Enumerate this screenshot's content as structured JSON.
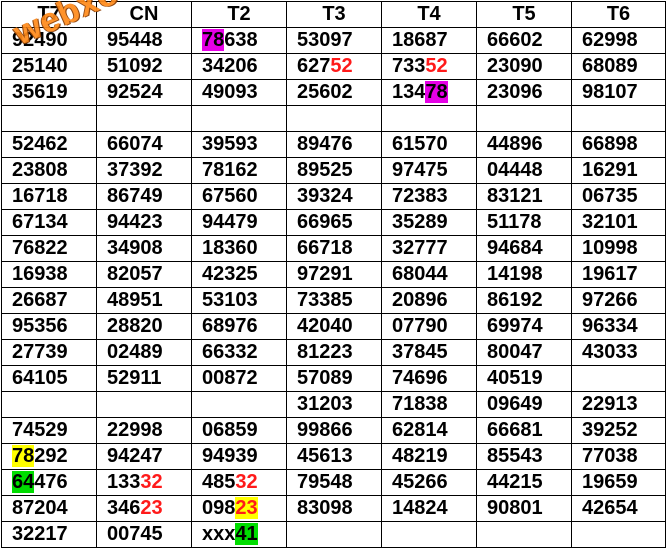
{
  "headers": [
    "T7",
    "CN",
    "T2",
    "T3",
    "T4",
    "T5",
    "T6"
  ],
  "watermark": "webxoso.net",
  "rows": [
    [
      {
        "t": "92490"
      },
      {
        "t": "95448"
      },
      {
        "p": "",
        "s": "78",
        "h": "magenta",
        "x": "638"
      },
      {
        "t": "53097"
      },
      {
        "t": "18687"
      },
      {
        "t": "66602"
      },
      {
        "t": "62998"
      }
    ],
    [
      {
        "t": "25140"
      },
      {
        "t": "51092"
      },
      {
        "t": "34206"
      },
      {
        "p": "627",
        "s": "52",
        "h": "red"
      },
      {
        "p": "733",
        "s": "52",
        "h": "red"
      },
      {
        "t": "23090"
      },
      {
        "t": "68089"
      }
    ],
    [
      {
        "t": "35619"
      },
      {
        "t": "92524"
      },
      {
        "t": "49093"
      },
      {
        "t": "25602"
      },
      {
        "p": "134",
        "s": "78",
        "h": "magenta"
      },
      {
        "t": "23096"
      },
      {
        "t": "98107"
      }
    ],
    [
      {
        "t": ""
      },
      {
        "t": ""
      },
      {
        "t": ""
      },
      {
        "t": ""
      },
      {
        "t": ""
      },
      {
        "t": ""
      },
      {
        "t": ""
      }
    ],
    [
      {
        "t": "52462"
      },
      {
        "t": "66074"
      },
      {
        "t": "39593"
      },
      {
        "t": "89476"
      },
      {
        "t": "61570"
      },
      {
        "t": "44896"
      },
      {
        "t": "66898"
      }
    ],
    [
      {
        "t": "23808"
      },
      {
        "t": "37392"
      },
      {
        "t": "78162"
      },
      {
        "t": "89525"
      },
      {
        "t": "97475"
      },
      {
        "t": "04448"
      },
      {
        "t": "16291"
      }
    ],
    [
      {
        "t": "16718"
      },
      {
        "t": "86749"
      },
      {
        "t": "67560"
      },
      {
        "t": "39324"
      },
      {
        "t": "72383"
      },
      {
        "t": "83121"
      },
      {
        "t": "06735"
      }
    ],
    [
      {
        "t": "67134"
      },
      {
        "t": "94423"
      },
      {
        "t": "94479"
      },
      {
        "t": "66965"
      },
      {
        "t": "35289"
      },
      {
        "t": "51178"
      },
      {
        "t": "32101"
      }
    ],
    [
      {
        "t": "76822"
      },
      {
        "t": "34908"
      },
      {
        "t": "18360"
      },
      {
        "t": "66718"
      },
      {
        "t": "32777"
      },
      {
        "t": "94684"
      },
      {
        "t": "10998"
      }
    ],
    [
      {
        "t": "16938"
      },
      {
        "t": "82057"
      },
      {
        "t": "42325"
      },
      {
        "t": "97291"
      },
      {
        "t": "68044"
      },
      {
        "t": "14198"
      },
      {
        "t": "19617"
      }
    ],
    [
      {
        "t": "26687"
      },
      {
        "t": "48951"
      },
      {
        "t": "53103"
      },
      {
        "t": "73385"
      },
      {
        "t": "20896"
      },
      {
        "t": "86192"
      },
      {
        "t": "97266"
      }
    ],
    [
      {
        "t": "95356"
      },
      {
        "t": "28820"
      },
      {
        "t": "68976"
      },
      {
        "t": "42040"
      },
      {
        "t": "07790"
      },
      {
        "t": "69974"
      },
      {
        "t": "96334"
      }
    ],
    [
      {
        "t": "27739"
      },
      {
        "t": "02489"
      },
      {
        "t": "66332"
      },
      {
        "t": "81223"
      },
      {
        "t": "37845"
      },
      {
        "t": "80047"
      },
      {
        "t": "43033"
      }
    ],
    [
      {
        "t": "64105"
      },
      {
        "t": "52911"
      },
      {
        "t": "00872"
      },
      {
        "t": "57089"
      },
      {
        "t": "74696"
      },
      {
        "t": "40519"
      },
      {
        "t": ""
      }
    ],
    [
      {
        "t": ""
      },
      {
        "t": ""
      },
      {
        "t": ""
      },
      {
        "t": "31203"
      },
      {
        "t": "71838"
      },
      {
        "t": "09649"
      },
      {
        "t": "22913"
      }
    ],
    [
      {
        "t": "74529"
      },
      {
        "t": "22998"
      },
      {
        "t": "06859"
      },
      {
        "t": "99866"
      },
      {
        "t": "62814"
      },
      {
        "t": "66681"
      },
      {
        "t": "39252"
      }
    ],
    [
      {
        "p": "",
        "s": "78",
        "h": "yellow",
        "x": "292"
      },
      {
        "t": "94247"
      },
      {
        "t": "94939"
      },
      {
        "t": "45613"
      },
      {
        "t": "48219"
      },
      {
        "t": "85543"
      },
      {
        "t": "77038"
      }
    ],
    [
      {
        "p": "",
        "s": "64",
        "h": "green",
        "x": "476"
      },
      {
        "p": "133",
        "s": "32",
        "h": "red"
      },
      {
        "p": "485",
        "s": "32",
        "h": "red"
      },
      {
        "t": "79548"
      },
      {
        "t": "45266"
      },
      {
        "t": "44215"
      },
      {
        "t": "19659"
      }
    ],
    [
      {
        "t": "87204"
      },
      {
        "p": "346",
        "s": "23",
        "h": "red"
      },
      {
        "p": "098",
        "s": "23",
        "h": "yellow-red"
      },
      {
        "t": "83098"
      },
      {
        "t": "14824"
      },
      {
        "t": "90801"
      },
      {
        "t": "42654"
      }
    ],
    [
      {
        "t": "32217"
      },
      {
        "t": "00745"
      },
      {
        "p": "xxx",
        "s": "41",
        "h": "green"
      },
      {
        "t": ""
      },
      {
        "t": ""
      },
      {
        "t": ""
      },
      {
        "t": ""
      }
    ]
  ]
}
